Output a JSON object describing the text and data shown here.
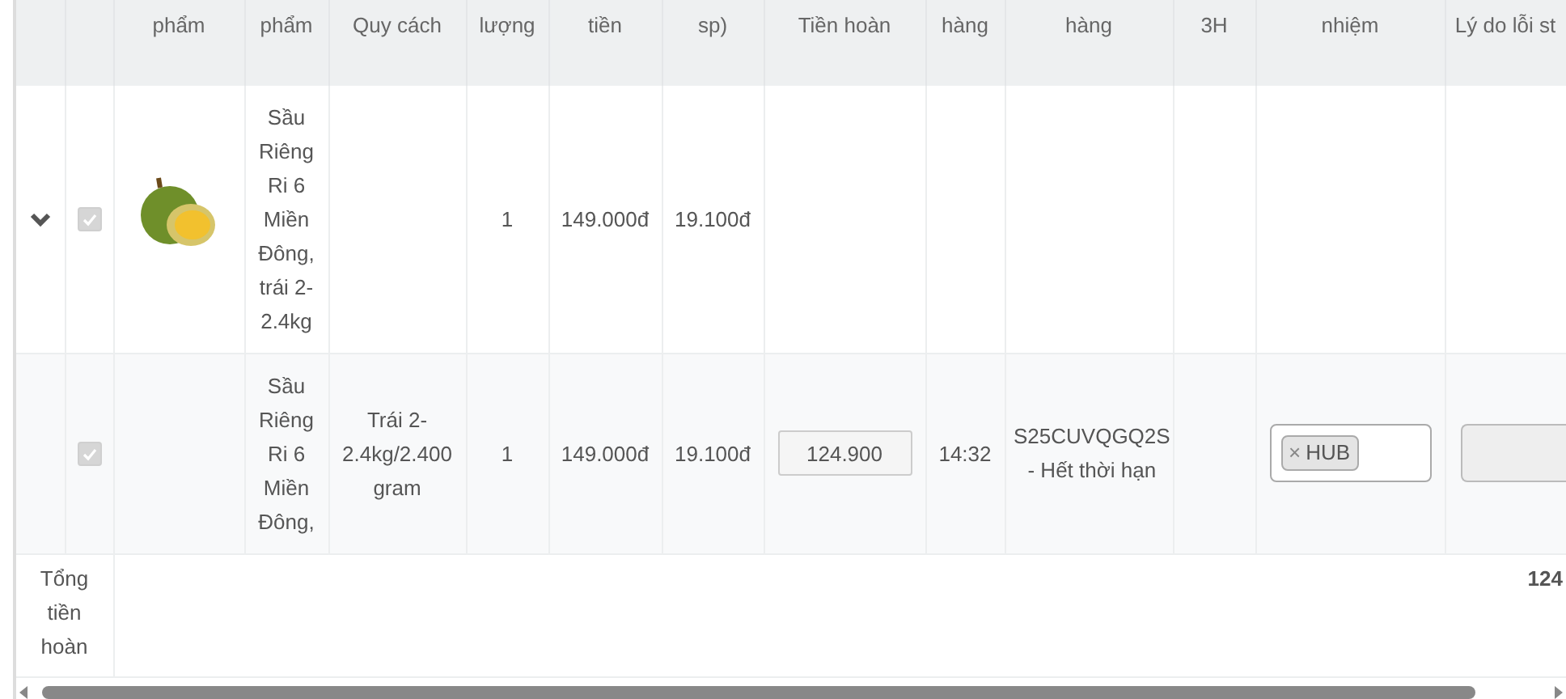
{
  "table": {
    "columns": [
      "phẩm",
      "phẩm",
      "Quy cách",
      "lượng",
      "tiền",
      "sp)",
      "Tiền hoàn",
      "hàng",
      "hàng",
      "3H",
      "nhiệm",
      "Lý do lỗi st"
    ],
    "rows": [
      {
        "kind": "group",
        "expanded": true,
        "checked": true,
        "disabled": true,
        "photo": true,
        "name": "Sầu Riêng Ri 6 Miền Đông, trái 2-2.4kg",
        "quantity": "1",
        "total": "149.000đ",
        "unit_price": "19.100đ"
      },
      {
        "kind": "item",
        "checked": true,
        "disabled": true,
        "name": "Sầu Riêng Ri 6 Miền Đông,",
        "spec": "Trái 2-2.4kg/2.400 gram",
        "quantity": "1",
        "total": "149.000đ",
        "unit_price": "19.100đ",
        "refund": "124.900",
        "delivery_time": "14:32",
        "code": "S25CUVQGQ2S - Hết thời hạn",
        "responsible_tags": [
          {
            "remove": "×",
            "label": "HUB"
          }
        ],
        "reason_disabled": true
      }
    ],
    "footer": {
      "label": "Tổng tiền hoàn",
      "value": "124"
    }
  }
}
